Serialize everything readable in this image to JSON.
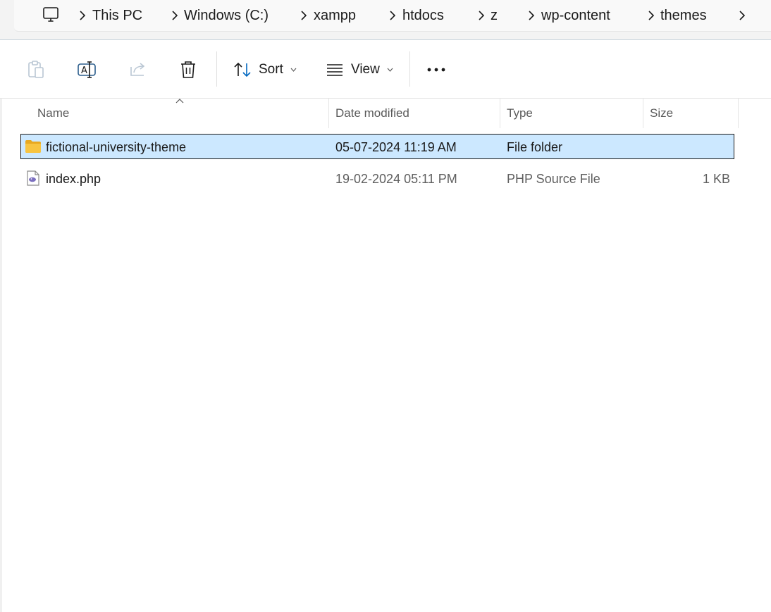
{
  "breadcrumb": {
    "items": [
      "This PC",
      "Windows (C:)",
      "xampp",
      "htdocs",
      "z",
      "wp-content",
      "themes"
    ]
  },
  "toolbar": {
    "sort_label": "Sort",
    "view_label": "View",
    "more_label": "•••"
  },
  "columns": {
    "name": "Name",
    "date": "Date modified",
    "type": "Type",
    "size": "Size"
  },
  "files": [
    {
      "name": "fictional-university-theme",
      "date": "05-07-2024 11:19 AM",
      "type": "File folder",
      "size": "",
      "icon": "folder-icon",
      "selected": true
    },
    {
      "name": "index.php",
      "date": "19-02-2024 05:11 PM",
      "type": "PHP Source File",
      "size": "1 KB",
      "icon": "php-file-icon",
      "selected": false
    }
  ],
  "colors": {
    "selection": "#cce8ff",
    "accent": "#0067c0",
    "folder": "#f8c440"
  }
}
